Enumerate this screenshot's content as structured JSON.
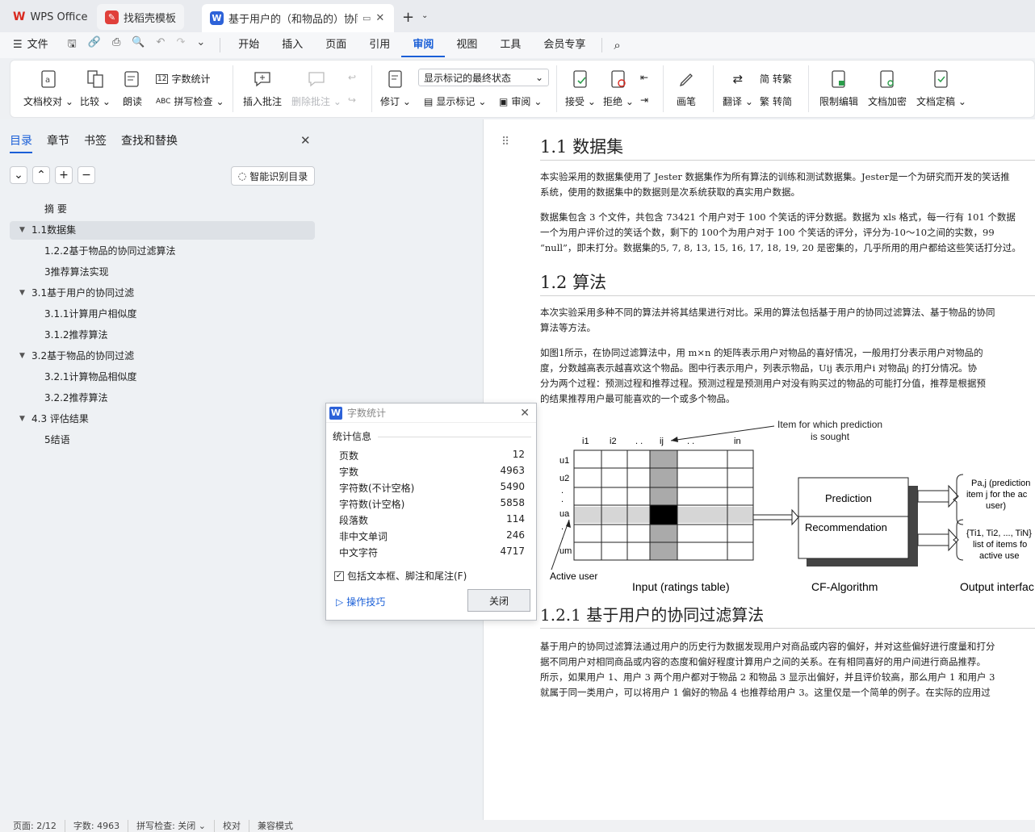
{
  "tabs": [
    {
      "label": "WPS Office",
      "icon": "wps-logo-icon",
      "color": "#d9281e"
    },
    {
      "label": "找稻壳模板",
      "icon": "docer-icon",
      "color": "#e0403a"
    },
    {
      "label": "基于用户的（和物品的）协同过",
      "icon": "writer-icon",
      "color": "#2d62d8"
    }
  ],
  "menu": {
    "file": "文件",
    "items": [
      "开始",
      "插入",
      "页面",
      "引用",
      "审阅",
      "视图",
      "工具",
      "会员专享"
    ],
    "active": "审阅"
  },
  "ribbon": {
    "doc_proof": "文档校对",
    "compare": "比较",
    "read_aloud": "朗读",
    "word_count": "字数统计",
    "spell_check": "拼写检查",
    "insert_comment": "插入批注",
    "delete_comment": "删除批注",
    "revise": "修订",
    "markup_state": "显示标记的最终状态",
    "show_markup": "显示标记",
    "review": "审阅",
    "accept": "接受",
    "reject": "拒绝",
    "pen": "画笔",
    "translate": "翻译",
    "to_traditional": "转繁",
    "to_simplified": "转简",
    "restrict_edit": "限制编辑",
    "encrypt": "文档加密",
    "finalize": "文档定稿"
  },
  "nav": {
    "tabs": [
      "目录",
      "章节",
      "书签",
      "查找和替换"
    ],
    "smart_toc": "智能识别目录",
    "toc": [
      {
        "label": "摘 要",
        "level": 1,
        "expand": ""
      },
      {
        "label": "1.1数据集",
        "level": 0,
        "expand": "▼",
        "selected": true
      },
      {
        "label": "1.2.2基于物品的协同过滤算法",
        "level": 1,
        "expand": ""
      },
      {
        "label": "3推荐算法实现",
        "level": 1,
        "expand": ""
      },
      {
        "label": "3.1基于用户的协同过滤",
        "level": 0,
        "expand": "▼"
      },
      {
        "label": "3.1.1计算用户相似度",
        "level": 1,
        "expand": ""
      },
      {
        "label": "3.1.2推荐算法",
        "level": 1,
        "expand": ""
      },
      {
        "label": "3.2基于物品的协同过滤",
        "level": 0,
        "expand": "▼"
      },
      {
        "label": "3.2.1计算物品相似度",
        "level": 1,
        "expand": ""
      },
      {
        "label": "3.2.2推荐算法",
        "level": 1,
        "expand": ""
      },
      {
        "label": "4.3 评估结果",
        "level": 0,
        "expand": "▼"
      },
      {
        "label": "5结语",
        "level": 1,
        "expand": ""
      }
    ]
  },
  "document": {
    "h1": "1.1 数据集",
    "p1": [
      "本实验采用的数据集使用了 Jester 数据集作为所有算法的训练和测试数据集。Jester是一个为研究而开发的笑话推",
      "系统，使用的数据集中的数据则是次系统获取的真实用户数据。"
    ],
    "p2": [
      "数据集包含 3 个文件，共包含 73421 个用户对于 100 个笑话的评分数据。数据为 xls 格式，每一行有 101 个数据",
      "一个为用户评价过的笑话个数，剩下的 100个为用户对于 100 个笑话的评分，评分为-10～10之间的实数，99",
      "“null”，即未打分。数据集的5, 7, 8, 13, 15, 16, 17, 18, 19, 20 是密集的，几乎所用的用户都给这些笑话打分过。"
    ],
    "h2": "1.2 算法",
    "p3": [
      "本次实验采用多种不同的算法并将其结果进行对比。采用的算法包括基于用户的协同过滤算法、基于物品的协同",
      "算法等方法。"
    ],
    "p4": [
      "如图1所示，在协同过滤算法中，用 m×n 的矩阵表示用户对物品的喜好情况，一般用打分表示用户对物品的",
      "度，分数越高表示越喜欢这个物品。图中行表示用户，列表示物品，Uij 表示用户i 对物品j 的打分情况。协",
      "分为两个过程：预测过程和推荐过程。预测过程是预测用户对没有购买过的物品的可能打分值，推荐是根据预",
      "的结果推荐用户最可能喜欢的一个或多个物品。"
    ],
    "figure": {
      "sought": [
        "Item for which prediction",
        "is sought"
      ],
      "col_labels": [
        "i1",
        "i2",
        ". .",
        "ij",
        ". .",
        "in"
      ],
      "row_labels": [
        "u1",
        "u2",
        ".",
        ".",
        "ua",
        ".",
        ".",
        "um"
      ],
      "prediction": "Prediction",
      "recommendation": "Recommendation",
      "out1": [
        "Pa,j (prediction",
        "item j for the ac",
        "user)"
      ],
      "out2": [
        "{Ti1, Ti2, ..., TiN}",
        "list of items fo",
        "active use"
      ],
      "active_user": "Active user",
      "input": "Input (ratings table)",
      "algo": "CF-Algorithm",
      "output": "Output interfac"
    },
    "h3": "1.2.1   基于用户的协同过滤算法",
    "p5": [
      "基于用户的协同过滤算法通过用户的历史行为数据发现用户对商品或内容的偏好，并对这些偏好进行度量和打分",
      "据不同用户对相同商品或内容的态度和偏好程度计算用户之间的关系。在有相同喜好的用户间进行商品推荐。",
      "所示，如果用户 1、用户 3 两个用户都对于物品 2 和物品 3 显示出偏好，并且评价较高，那么用户 1 和用户 3",
      "就属于同一类用户，可以将用户 1 偏好的物品 4 也推荐给用户 3。这里仅是一个简单的例子。在实际的应用过"
    ]
  },
  "dialog": {
    "title": "字数统计",
    "section": "统计信息",
    "rows": [
      {
        "label": "页数",
        "value": "12"
      },
      {
        "label": "字数",
        "value": "4963"
      },
      {
        "label": "字符数(不计空格)",
        "value": "5490"
      },
      {
        "label": "字符数(计空格)",
        "value": "5858"
      },
      {
        "label": "段落数",
        "value": "114"
      },
      {
        "label": "非中文单词",
        "value": "246"
      },
      {
        "label": "中文字符",
        "value": "4717"
      }
    ],
    "checkbox": "包括文本框、脚注和尾注(F)",
    "tips": "操作技巧",
    "close": "关闭"
  },
  "status": {
    "page": "页面: 2/12",
    "words": "字数: 4963",
    "spell": "拼写检查: 关闭",
    "proof": "校对",
    "compat": "兼容模式"
  }
}
